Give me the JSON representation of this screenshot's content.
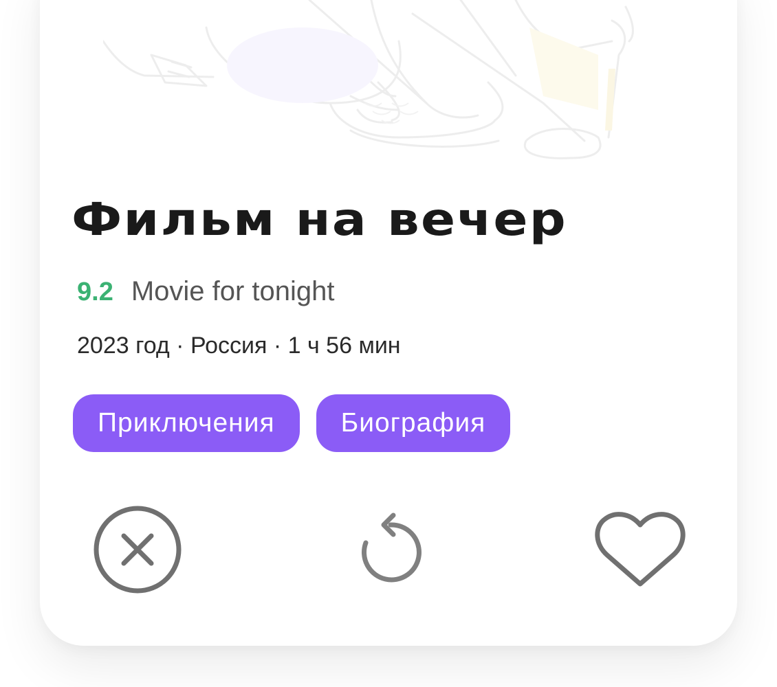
{
  "movie": {
    "title": "Фильм на вечер",
    "rating": "9.2",
    "original_title": "Movie for tonight",
    "meta": "2023 год · Россия · 1 ч 56 мин",
    "genres": [
      "Приключения",
      "Биография"
    ]
  },
  "actions": {
    "dislike_icon": "close-circle-icon",
    "undo_icon": "undo-arrow-icon",
    "like_icon": "heart-outline-icon"
  },
  "colors": {
    "rating": "#3bb273",
    "tag_background": "#8b5cf6",
    "tag_text": "#ffffff",
    "title": "#1a1a1a",
    "icon": "#707070"
  }
}
